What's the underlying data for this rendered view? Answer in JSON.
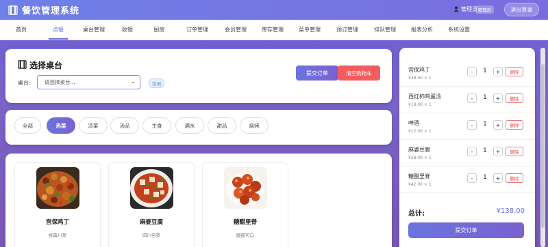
{
  "header": {
    "app_title": "餐饮管理系统",
    "user_name": "管理员",
    "role_badge": "管理员",
    "logout_label": "退出登录"
  },
  "nav": {
    "tabs": [
      "首页",
      "点餐",
      "桌台管理",
      "收银",
      "厨房",
      "订单管理",
      "会员管理",
      "库存管理",
      "菜单管理",
      "预订管理",
      "排队管理",
      "报表分析",
      "系统设置"
    ],
    "active": "点餐"
  },
  "table_section": {
    "title": "选择桌台",
    "label": "桌台:",
    "select_placeholder": "请选择桌台...",
    "status": "空闲",
    "submit_label": "提交订单",
    "clear_label": "清空购物车"
  },
  "categories": {
    "items": [
      "全部",
      "热菜",
      "凉菜",
      "汤品",
      "主食",
      "酒水",
      "甜品",
      "烧烤"
    ],
    "active": "热菜"
  },
  "dishes": [
    {
      "name": "宫保鸡丁",
      "desc": "经典川菜"
    },
    {
      "name": "麻婆豆腐",
      "desc": "四川名菜"
    },
    {
      "name": "糖醋里脊",
      "desc": "酸甜可口"
    }
  ],
  "cart": {
    "items": [
      {
        "name": "宫保鸡丁",
        "price": "¥38.00 × 1",
        "qty": "1",
        "delete_label": "删除"
      },
      {
        "name": "西红柿鸡蛋汤",
        "price": "¥18.00 × 1",
        "qty": "1",
        "delete_label": "删除"
      },
      {
        "name": "啤酒",
        "price": "¥12.00 × 1",
        "qty": "1",
        "delete_label": "删除"
      },
      {
        "name": "麻婆豆腐",
        "price": "¥28.00 × 1",
        "qty": "1",
        "delete_label": "删除"
      },
      {
        "name": "糖醋里脊",
        "price": "¥42.00 × 1",
        "qty": "1",
        "delete_label": "删除"
      }
    ],
    "minus": "-",
    "plus": "+",
    "total_label": "总计:",
    "total_value": "¥138.00",
    "submit_label": "提交订单"
  },
  "colors": {
    "accent": "#6a6de0",
    "danger": "#f25c5c",
    "header_start": "#6f80e9",
    "header_end": "#7a6ddf"
  },
  "icons": {
    "logo": "clapperboard-icon",
    "user": "user-icon",
    "section": "clapperboard-icon",
    "select": "chevron-down-icon"
  }
}
